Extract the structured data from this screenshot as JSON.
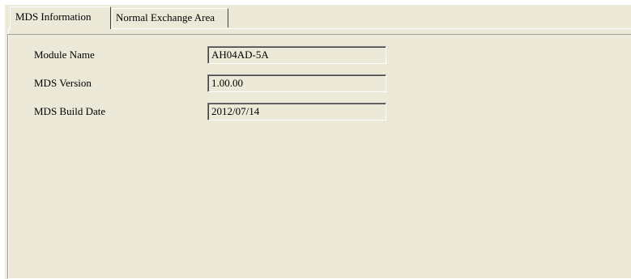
{
  "tabs": [
    {
      "label": "MDS Information",
      "active": true
    },
    {
      "label": "Normal Exchange Area",
      "active": false
    }
  ],
  "fields": [
    {
      "label": "Module Name",
      "value": "AH04AD-5A"
    },
    {
      "label": "MDS Version",
      "value": "1.00.00"
    },
    {
      "label": "MDS Build Date",
      "value": "2012/07/14"
    }
  ],
  "colors": {
    "background": "#ece9d8",
    "highlight": "#ffffff",
    "shadow": "#808080"
  }
}
